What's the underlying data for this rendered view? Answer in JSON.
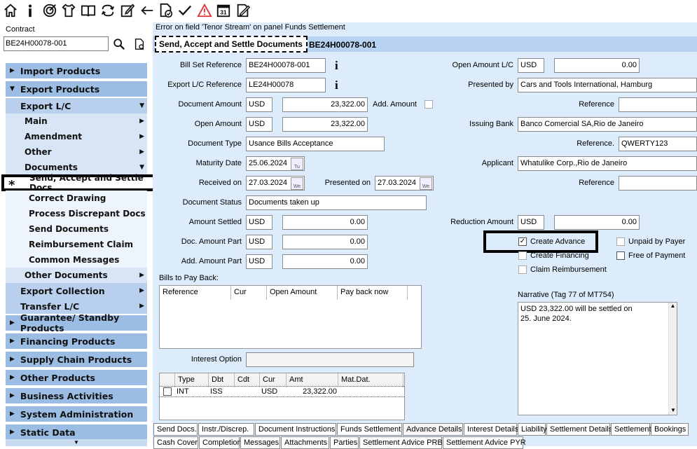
{
  "toolbar": {
    "icons": [
      "home-icon",
      "info-icon",
      "target-icon",
      "shirt-icon",
      "book-icon",
      "transfer-icon",
      "edit-icon",
      "back-arrow-icon",
      "document-check-icon",
      "checkmark-icon",
      "warning-icon",
      "calendar-icon",
      "signature-icon"
    ],
    "calendar_day": "31"
  },
  "contract": {
    "label": "Contract",
    "value": "BE24H00078-001"
  },
  "nav": [
    {
      "level": 1,
      "label": "Import Products",
      "icon": "right"
    },
    {
      "level": 1,
      "label": "Export Products",
      "icon": "down"
    },
    {
      "level": 2,
      "label": "Export L/C",
      "arrow": "▼"
    },
    {
      "level": 3,
      "label": "Main",
      "arrow": "▶"
    },
    {
      "level": 3,
      "label": "Amendment",
      "arrow": "▶"
    },
    {
      "level": 3,
      "label": "Other",
      "arrow": "▶"
    },
    {
      "level": 3,
      "label": "Documents",
      "arrow": "▼"
    },
    {
      "level": 4,
      "label": "Send, Accept and Settle Docs",
      "marker": "*",
      "selected": true
    },
    {
      "level": 4,
      "label": "Correct Drawing"
    },
    {
      "level": 4,
      "label": "Process Discrepant Docs"
    },
    {
      "level": 4,
      "label": "Send Documents"
    },
    {
      "level": 4,
      "label": "Reimbursement Claim"
    },
    {
      "level": 4,
      "label": "Common Messages"
    },
    {
      "level": 3,
      "label": "Other Documents",
      "arrow": "▶"
    },
    {
      "level": 2,
      "label": "Export Collection",
      "arrow": "▶"
    },
    {
      "level": 2,
      "label": "Transfer L/C",
      "arrow": "▶"
    },
    {
      "level": 1,
      "label": "Guarantee/ Standby Products",
      "icon": "right"
    },
    {
      "level": 1,
      "label": "Financing Products",
      "icon": "right"
    },
    {
      "level": 1,
      "label": "Supply Chain Products",
      "icon": "right"
    },
    {
      "level": 1,
      "label": "Other Products",
      "icon": "right"
    },
    {
      "level": 1,
      "label": "Business Activities",
      "icon": "right"
    },
    {
      "level": 1,
      "label": "System Administration",
      "icon": "right"
    },
    {
      "level": 1,
      "label": "Static Data",
      "icon": "right"
    }
  ],
  "error_line": "Error on field 'Tenor Stream' on panel Funds Settlement",
  "header": {
    "title": "Send, Accept and Settle Documents",
    "ref": "BE24H00078-001"
  },
  "form": {
    "bill_set_reference": {
      "label": "Bill Set Reference",
      "value": "BE24H00078-001"
    },
    "export_lc_reference": {
      "label": "Export L/C Reference",
      "value": "LE24H00078"
    },
    "document_amount": {
      "label": "Document Amount",
      "cur": "USD",
      "value": "23,322.00"
    },
    "add_amount": {
      "label": "Add. Amount"
    },
    "open_amount": {
      "label": "Open Amount",
      "cur": "USD",
      "value": "23,322.00"
    },
    "document_type": {
      "label": "Document Type",
      "value": "Usance Bills Acceptance"
    },
    "maturity_date": {
      "label": "Maturity Date",
      "value": "25.06.2024",
      "cal": "Tu"
    },
    "received_on": {
      "label": "Received on",
      "value": "27.03.2024",
      "cal": "We"
    },
    "presented_on": {
      "label": "Presented on",
      "value": "27.03.2024",
      "cal": "We"
    },
    "document_status": {
      "label": "Document Status",
      "value": "Documents taken up"
    },
    "amount_settled": {
      "label": "Amount Settled",
      "cur": "USD",
      "value": "0.00"
    },
    "doc_amount_part": {
      "label": "Doc. Amount Part",
      "cur": "USD",
      "value": "0.00"
    },
    "add_amount_part": {
      "label": "Add. Amount Part",
      "cur": "USD",
      "value": "0.00"
    },
    "open_amount_lc": {
      "label": "Open Amount L/C",
      "cur": "USD",
      "value": "0.00"
    },
    "presented_by": {
      "label": "Presented by",
      "value": "Cars and Tools International, Hamburg"
    },
    "reference1": {
      "label": "Reference",
      "value": ""
    },
    "issuing_bank": {
      "label": "Issuing Bank",
      "value": "Banco Comercial SA,Rio de Janeiro"
    },
    "reference2": {
      "label": "Reference.",
      "value": "QWERTY123"
    },
    "applicant": {
      "label": "Applicant",
      "value": "Whatulike Corp.,Rio de Janeiro"
    },
    "reference3": {
      "label": "Reference",
      "value": ""
    },
    "reduction_amount": {
      "label": "Reduction Amount",
      "cur": "USD",
      "value": "0.00"
    },
    "create_advance": {
      "label": "Create Advance",
      "checked": true
    },
    "create_financing": {
      "label": "Create Financing",
      "checked": false
    },
    "claim_reimbursement": {
      "label": "Claim Reimbursement",
      "checked": false
    },
    "unpaid_by_payer": {
      "label": "Unpaid by Payer",
      "checked": false
    },
    "free_of_payment": {
      "label": "Free of Payment",
      "checked": false
    },
    "bills_to_pay_back": {
      "label": "Bills to Pay Back:",
      "columns": [
        "Reference",
        "Cur",
        "Open Amount",
        "Pay back now"
      ]
    },
    "narrative": {
      "label": "Narrative (Tag 77 of MT754)",
      "line1": "USD 23,322.00 will be settled on",
      "line2": "25. June 2024."
    },
    "interest_option": {
      "label": "Interest Option",
      "value": ""
    },
    "settlement_grid": {
      "columns": [
        "Type",
        "Dbt",
        "Cdt",
        "Cur",
        "Amt",
        "Mat.Dat."
      ],
      "row": {
        "type": "INT",
        "dbt": "ISS",
        "cdt": "",
        "cur": "USD",
        "amt": "23,322.00",
        "mat": ""
      }
    }
  },
  "tabs_row1": [
    "Send Docs.",
    "Instr./Discrep.",
    "Document Instructions",
    "Funds Settlement",
    "Advance Details",
    "Interest Details",
    "Liability",
    "Settlement Details",
    "Settlement",
    "Bookings"
  ],
  "tabs_row2": [
    "Cash Cover",
    "Completion",
    "Messages",
    "Attachments",
    "Parties",
    "Settlement Advice PRB",
    "Settlement Advice PYR"
  ]
}
